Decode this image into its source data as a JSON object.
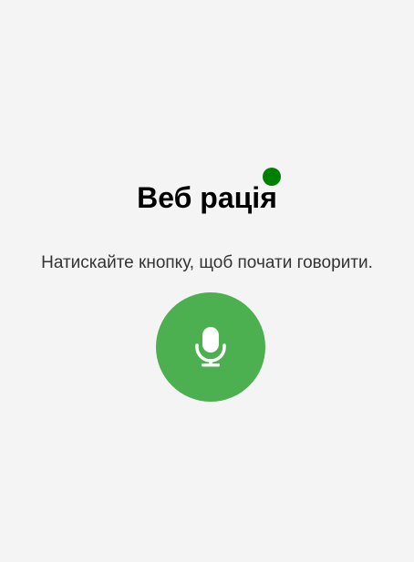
{
  "app": {
    "title": "Веб рація",
    "instruction": "Натискайте кнопку, щоб почати говорити."
  },
  "status": {
    "indicator_color": "#008000"
  },
  "mic_button": {
    "icon": "microphone-icon",
    "background_color": "#4caf50"
  }
}
